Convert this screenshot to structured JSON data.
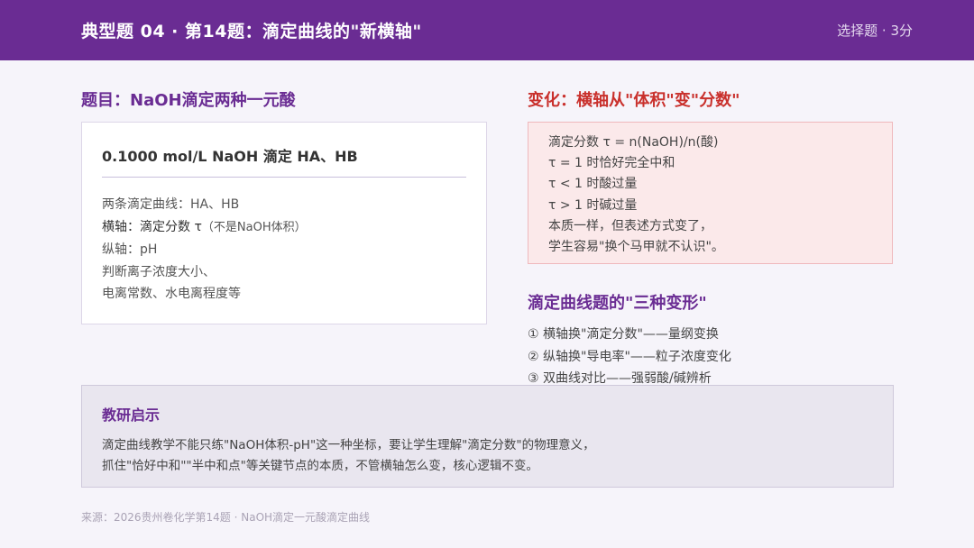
{
  "header": {
    "title": "典型题 04 · 第14题：滴定曲线的\"新横轴\"",
    "meta": "选择题 · 3分"
  },
  "left": {
    "section_title": "题目：NaOH滴定两种一元酸",
    "card": {
      "title": "0.1000 mol/L NaOH 滴定 HA、HB",
      "line1": "两条滴定曲线：HA、HB",
      "line2_main": "横轴：滴定分数 τ",
      "line2_note": "（不是NaOH体积）",
      "line3": "纵轴：pH",
      "line4": "判断离子浓度大小、",
      "line5": "电离常数、水电离程度等"
    }
  },
  "right": {
    "section_title": "变化：横轴从\"体积\"变\"分数\"",
    "card_lines": [
      "滴定分数 τ = n(NaOH)/n(酸)",
      "τ = 1 时恰好完全中和",
      "τ < 1 时酸过量",
      "τ > 1 时碱过量",
      "本质一样，但表述方式变了，",
      "学生容易\"换个马甲就不认识\"。"
    ],
    "variants_title": "滴定曲线题的\"三种变形\"",
    "variants": [
      "① 横轴换\"滴定分数\"——量纲变换",
      "② 纵轴换\"导电率\"——粒子浓度变化",
      "③ 双曲线对比——强弱酸/碱辨析"
    ]
  },
  "insight": {
    "title": "教研启示",
    "line1": "滴定曲线教学不能只练\"NaOH体积-pH\"这一种坐标，要让学生理解\"滴定分数\"的物理意义，",
    "line2": "抓住\"恰好中和\"\"半中和点\"等关键节点的本质，不管横轴怎么变，核心逻辑不变。"
  },
  "footer": "来源：2026贵州卷化学第14题 · NaOH滴定一元酸滴定曲线",
  "colors": {
    "brand_purple": "#6a2c93",
    "accent_red": "#c9302c",
    "pink_card": "#fbe9ea"
  }
}
